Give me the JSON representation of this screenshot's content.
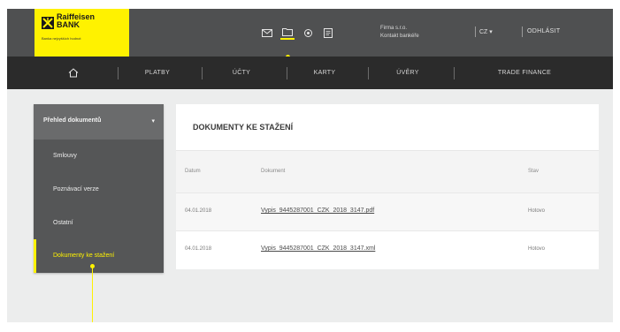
{
  "brand": {
    "name": "Raiffeisen",
    "bank": "BANK",
    "tagline": "Banka nejvyšších hodnot",
    "color": "#fff200"
  },
  "header": {
    "icons": [
      "mail-icon",
      "folder-icon",
      "settings-icon",
      "document-icon"
    ],
    "active_icon": "folder-icon",
    "user_line1": "Firma s.r.o.",
    "user_line2": "Kontakt bankéře",
    "lang": "CZ ▾",
    "logout": "ODHLÁSIT"
  },
  "nav": {
    "home_icon": "home-icon",
    "items": [
      "PLATBY",
      "ÚČTY",
      "KARTY",
      "ÚVĚRY",
      "TRADE FINANCE"
    ]
  },
  "sidebar": {
    "header": "Přehled dokumentů",
    "caret": "▾",
    "items": [
      {
        "label": "Smlouvy"
      },
      {
        "label": "Poznávací verze"
      },
      {
        "label": "Ostatní"
      },
      {
        "label": "Dokumenty ke stažení"
      }
    ]
  },
  "main": {
    "title": "DOKUMENTY KE STAŽENÍ",
    "columns": [
      "Datum",
      "Dokument",
      "Stav"
    ],
    "rows": [
      {
        "date": "04.01.2018",
        "document": "Vypis_9445287001_CZK_2018_3147.pdf",
        "status": "Hotovo"
      },
      {
        "date": "04.01.2018",
        "document": "Vypis_9445287001_CZK_2018_3147.xml",
        "status": "Hotovo"
      }
    ]
  }
}
